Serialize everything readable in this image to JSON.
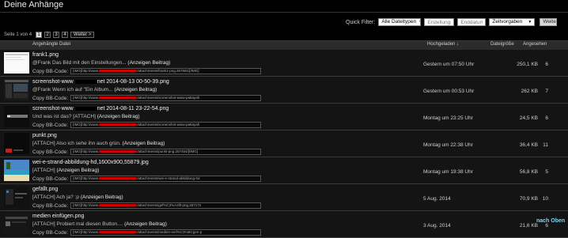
{
  "page": {
    "title": "Deine Anhänge"
  },
  "filter": {
    "label": "Quick Filter:",
    "type_select": "Alle Dateitypen",
    "created_placeholder": "Erstellungsda",
    "end_placeholder": "Enddatum",
    "period_select": "Zeitvorgaben",
    "go_label": "Weiter"
  },
  "pagination": {
    "info": "Seite 1 von 4",
    "pages": [
      "1",
      "2",
      "3",
      "4"
    ],
    "next": "Weiter >"
  },
  "table": {
    "col_date": "Angehängte Datei",
    "col_uploaded": "Hochgeladen ↓",
    "col_size": "Dateigröße",
    "col_views": "Angesehen",
    "copy_label": "Copy BB-Code:",
    "rows": [
      {
        "file": "frank1.png",
        "snippet": "@Frank Das Bild mit den Einstellungen... ",
        "post": "(Anzeigen Beitrag)",
        "bb_prefix": "[IMG]http://www.",
        "bb_suffix": "/attachments/frank1-png.257681/[/IMG]",
        "date": "Gestern um 07:50 Uhr",
        "size": "250,1 KB",
        "views": "6"
      },
      {
        "file_a": "screenshot-www",
        "file_b": "net 2014-08-13 00-50-39.png",
        "snippet": "@Frank Wenn ich auf \"Ein Album... ",
        "post": "(Anzeigen Beitrag)",
        "bb_prefix": "[IMG]http://www.",
        "bb_suffix": "/attachments/screenshot-www-pattayah",
        "date": "Gestern um 00:53 Uhr",
        "size": "262 KB",
        "views": "7"
      },
      {
        "file_a": "screenshot-www",
        "file_b": "net 2014-08-11 23-22-54.png",
        "snippet": "Und was ist das? [ATTACH] ",
        "post": "(Anzeigen Beitrag)",
        "bb_prefix": "[IMG]http://www.",
        "bb_suffix": "/attachments/screenshot-www-pattayah",
        "date": "Montag um 23:25 Uhr",
        "size": "24,5 KB",
        "views": "6"
      },
      {
        "file": "punkt.png",
        "snippet": "[ATTACH] Also ich sehe ihn auch grün. ",
        "post": "(Anzeigen Beitrag)",
        "bb_prefix": "[IMG]http://www.",
        "bb_suffix": "/attachments/punkt-png.257454/[/IMG]",
        "date": "Montag um 22:38 Uhr",
        "size": "36,4 KB",
        "views": "11"
      },
      {
        "file": "wei-e-strand-abbildung-hd,1600x900,55879.jpg",
        "snippet": "[ATTACH] ",
        "post": "(Anzeigen Beitrag)",
        "bb_prefix": "[IMG]http://www.",
        "bb_suffix": "/attachments/wei-e-strand-abbildung-hd",
        "date": "Montag um 19:38 Uhr",
        "size": "56,8 KB",
        "views": "5"
      },
      {
        "file": "gefällt.png",
        "snippet": "[ATTACH] Ach ja? :p ",
        "post": "(Anzeigen Beitrag)",
        "bb_prefix": "[IMG]http://www.",
        "bb_suffix": "/attachments/gef%C3%A4llt-png.257172",
        "date": "5 Aug. 2014",
        "size": "70,9 KB",
        "views": "10"
      },
      {
        "file": "medien einfügen.png",
        "snippet": "[ATTACH] Probiert mal diesen Button.... ",
        "post": "(Anzeigen Beitrag)",
        "bb_prefix": "[IMG]http://www.",
        "bb_suffix": "/attachments/medien-einf%C3%BCgen-p",
        "date": "3 Aug. 2014",
        "size": "21,6 KB",
        "views": "6"
      }
    ]
  },
  "footer": {
    "back_to_top": "nach Oben"
  }
}
